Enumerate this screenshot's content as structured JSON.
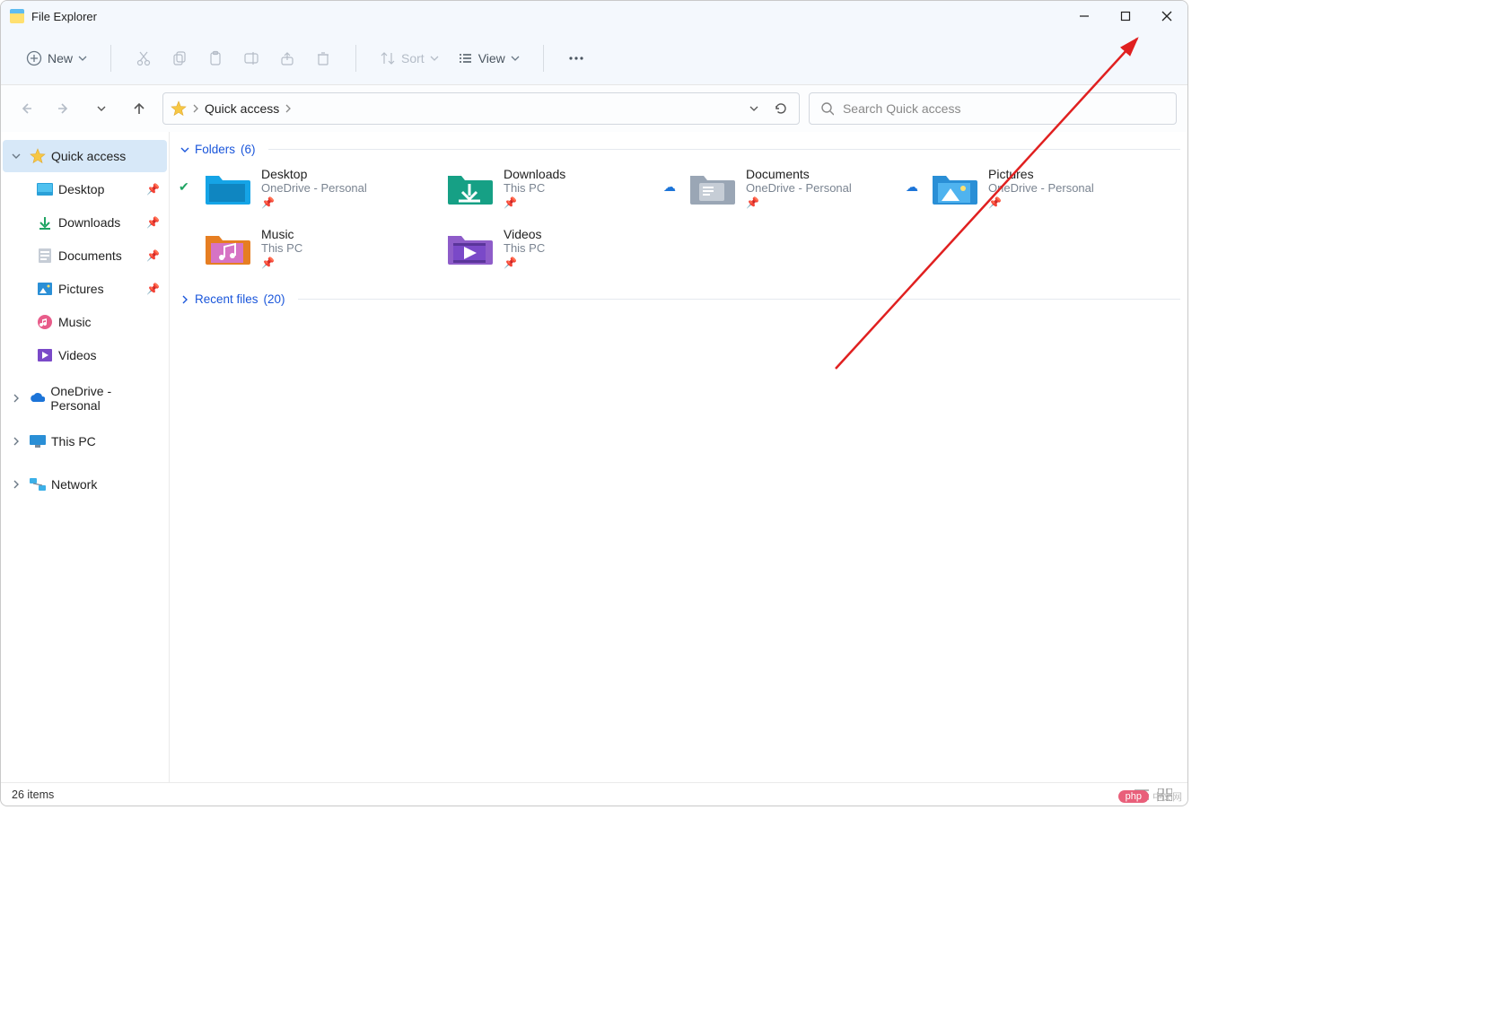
{
  "title": "File Explorer",
  "toolbar": {
    "new_label": "New",
    "sort_label": "Sort",
    "view_label": "View"
  },
  "nav": {
    "breadcrumb": "Quick access"
  },
  "search": {
    "placeholder": "Search Quick access"
  },
  "sidebar": {
    "quick_access": "Quick access",
    "items": [
      {
        "label": "Desktop",
        "pinned": true,
        "icon": "desktop"
      },
      {
        "label": "Downloads",
        "pinned": true,
        "icon": "downloads"
      },
      {
        "label": "Documents",
        "pinned": true,
        "icon": "documents"
      },
      {
        "label": "Pictures",
        "pinned": true,
        "icon": "pictures"
      },
      {
        "label": "Music",
        "pinned": false,
        "icon": "music"
      },
      {
        "label": "Videos",
        "pinned": false,
        "icon": "videos"
      }
    ],
    "onedrive": "OneDrive - Personal",
    "thispc": "This PC",
    "network": "Network"
  },
  "sections": {
    "folders_label": "Folders",
    "folders_count": "(6)",
    "recent_label": "Recent files",
    "recent_count": "(20)"
  },
  "folders": [
    {
      "name": "Desktop",
      "sub": "OneDrive - Personal",
      "icon": "desktop",
      "overlay": "check"
    },
    {
      "name": "Downloads",
      "sub": "This PC",
      "icon": "downloads",
      "overlay": null
    },
    {
      "name": "Documents",
      "sub": "OneDrive - Personal",
      "icon": "documents",
      "overlay": "cloud"
    },
    {
      "name": "Pictures",
      "sub": "OneDrive - Personal",
      "icon": "pictures",
      "overlay": "cloud"
    },
    {
      "name": "Music",
      "sub": "This PC",
      "icon": "music",
      "overlay": null
    },
    {
      "name": "Videos",
      "sub": "This PC",
      "icon": "videos",
      "overlay": null
    }
  ],
  "status": {
    "count": "26 items"
  },
  "watermark": {
    "brand": "php",
    "text": "中文网"
  }
}
